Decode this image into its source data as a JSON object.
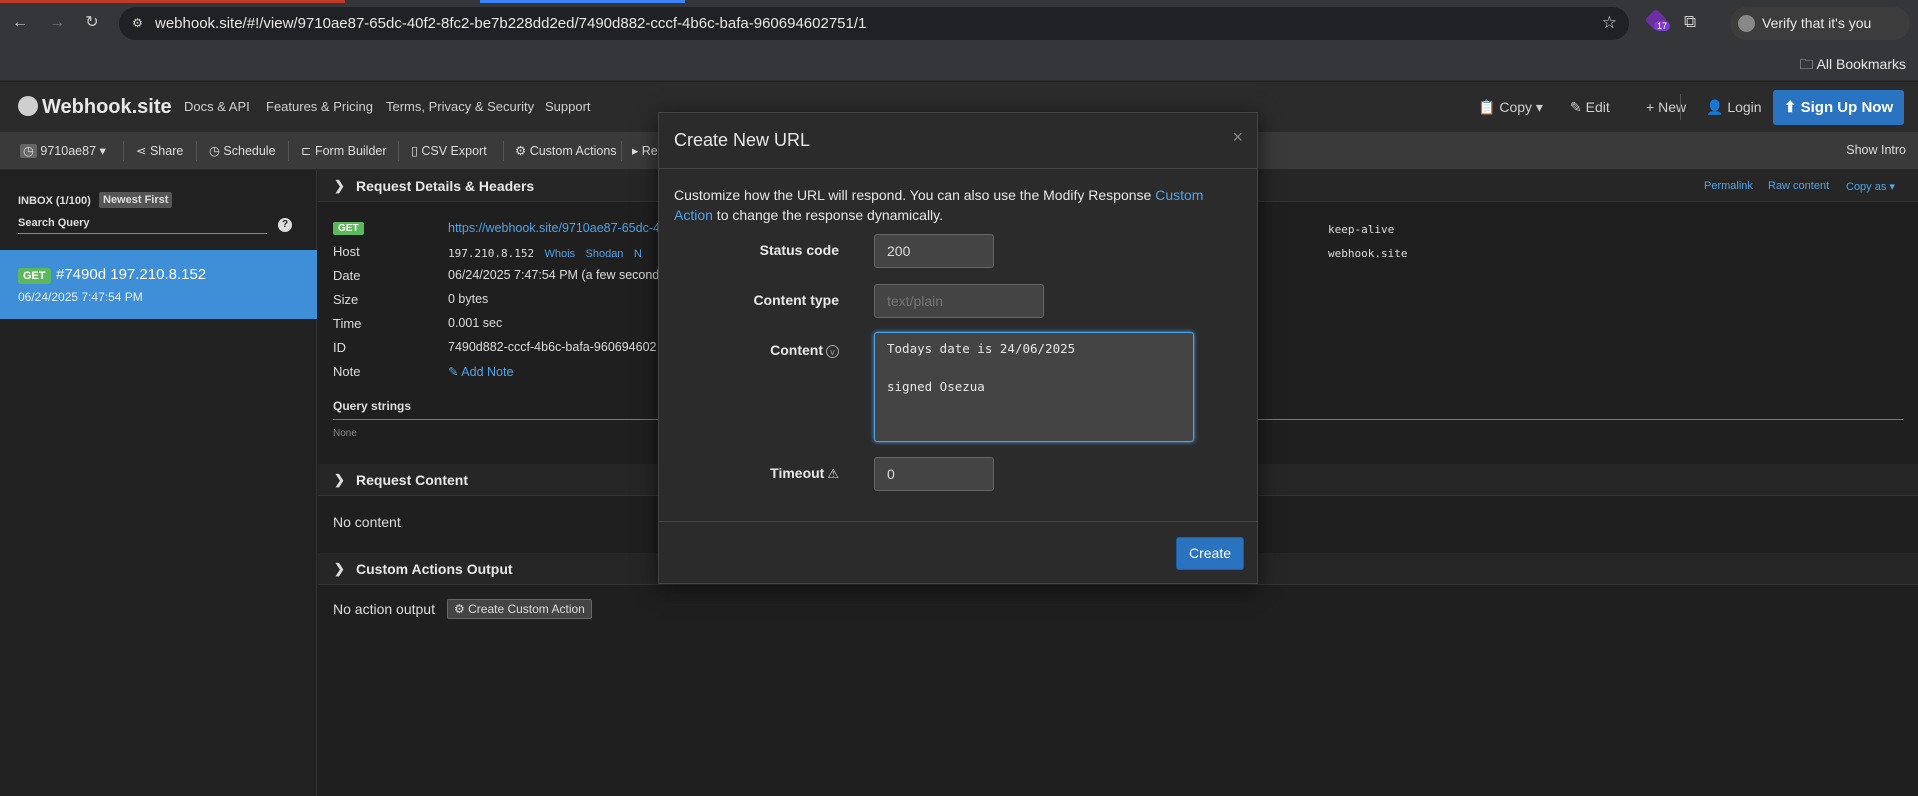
{
  "browser": {
    "url": "webhook.site/#!/view/9710ae87-65dc-40f2-8fc2-be7b228dd2ed/7490d882-cccf-4b6c-bafa-960694602751/1",
    "extension_count": "17",
    "verify_label": "Verify that it's you",
    "bookmarks_label": "All Bookmarks"
  },
  "appnav": {
    "brand": "Webhook.site",
    "links": [
      "Docs & API",
      "Features & Pricing",
      "Terms, Privacy & Security",
      "Support"
    ],
    "copy": "Copy",
    "edit": "Edit",
    "new": "New",
    "login": "Login",
    "signup": "Sign Up Now"
  },
  "toolbar": {
    "token": "9710ae87",
    "share": "Share",
    "schedule": "Schedule",
    "form_builder": "Form Builder",
    "csv_export": "CSV Export",
    "custom_actions": "Custom Actions",
    "truncated": "Re",
    "show_intro": "Show Intro"
  },
  "sidebar": {
    "inbox": "INBOX (1/100)",
    "newest_first": "Newest First",
    "search_query": "Search Query",
    "request": {
      "method": "GET",
      "title": "#7490d 197.210.8.152",
      "timestamp": "06/24/2025 7:47:54 PM"
    }
  },
  "details": {
    "section_title": "Request Details & Headers",
    "permalink": "Permalink",
    "raw_content": "Raw content",
    "copy_as": "Copy as",
    "method": "GET",
    "url": "https://webhook.site/9710ae87-65dc-4",
    "host_label": "Host",
    "host_ip": "197.210.8.152",
    "whois": "Whois",
    "shodan": "Shodan",
    "host_more": "N",
    "date_label": "Date",
    "date_value": "06/24/2025 7:47:54 PM (a few second",
    "size_label": "Size",
    "size_value": "0 bytes",
    "time_label": "Time",
    "time_value": "0.001 sec",
    "id_label": "ID",
    "id_value": "7490d882-cccf-4b6c-bafa-960694602",
    "note_label": "Note",
    "add_note": "Add Note",
    "header_connection": "keep-alive",
    "header_host": "webhook.site",
    "query_strings": "Query strings",
    "none": "None"
  },
  "request_content": {
    "title": "Request Content",
    "body": "No content"
  },
  "custom_actions_output": {
    "title": "Custom Actions Output",
    "body": "No action output",
    "button": "Create Custom Action"
  },
  "modal": {
    "title": "Create New URL",
    "close": "×",
    "description": "Customize how the URL will respond. You can also use the Modify Response ",
    "desc_link": "Custom Action",
    "desc_tail": " to change the response dynamically.",
    "status_code_label": "Status code",
    "status_code_value": "200",
    "content_type_label": "Content type",
    "content_type_placeholder": "text/plain",
    "content_label": "Content",
    "content_value": "Todays date is 24/06/2025\n\nsigned Osezua",
    "timeout_label": "Timeout",
    "timeout_value": "0",
    "create": "Create"
  },
  "colors": {
    "accent": "#2a73c1",
    "selected_row": "#3e8fd8",
    "get_badge": "#5cb85c",
    "link": "#4fa3e8"
  }
}
